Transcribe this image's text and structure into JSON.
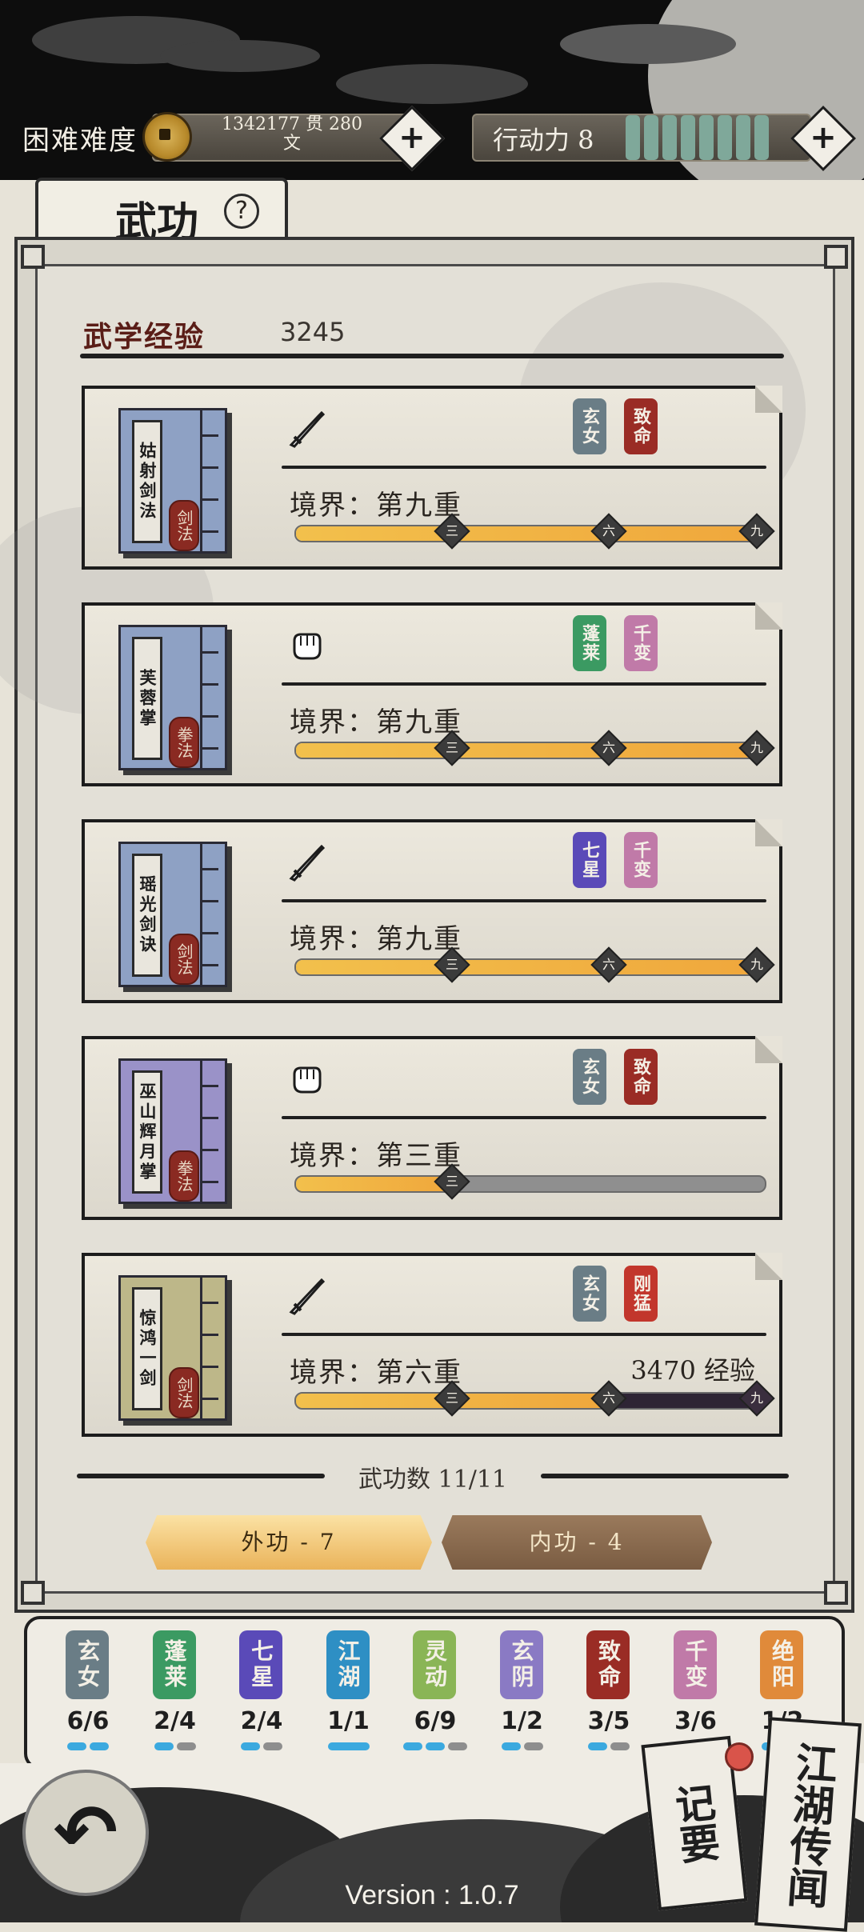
{
  "header": {
    "difficulty": "困难难度",
    "money_line1": "1342177 贯  280",
    "money_line2": "文",
    "add_money_label": "+",
    "action_power_label": "行动力 8",
    "action_power_value": 8,
    "add_power_label": "+"
  },
  "tab": {
    "title": "武功",
    "help": "?"
  },
  "experience": {
    "label": "武学经验",
    "value": "3245"
  },
  "skills": [
    {
      "name": "姑射剑法",
      "type": "剑法",
      "weapon_icon": "sword-icon",
      "realm": "境界：第九重",
      "exp": "",
      "progress": 1.0,
      "book_color": "#8ea1c4",
      "seals": [
        {
          "text": "玄女",
          "color": "#6a7d86"
        },
        {
          "text": "致命",
          "color": "#9a2c25"
        }
      ]
    },
    {
      "name": "芙蓉掌",
      "type": "拳法",
      "weapon_icon": "fist-icon",
      "realm": "境界：第九重",
      "exp": "",
      "progress": 1.0,
      "book_color": "#8ea1c4",
      "seals": [
        {
          "text": "蓬莱",
          "color": "#3b9a62"
        },
        {
          "text": "千变",
          "color": "#c07aa8"
        }
      ]
    },
    {
      "name": "瑶光剑诀",
      "type": "剑法",
      "weapon_icon": "sword-icon",
      "realm": "境界：第九重",
      "exp": "",
      "progress": 1.0,
      "book_color": "#8ea1c4",
      "seals": [
        {
          "text": "七星",
          "color": "#5a4ab8"
        },
        {
          "text": "千变",
          "color": "#c07aa8"
        }
      ]
    },
    {
      "name": "巫山辉月掌",
      "type": "拳法",
      "weapon_icon": "fist-icon",
      "realm": "境界：第三重",
      "exp": "",
      "progress": 0.333,
      "book_color": "#9a92c8",
      "seals": [
        {
          "text": "玄女",
          "color": "#6a7d86"
        },
        {
          "text": "致命",
          "color": "#9a2c25"
        }
      ]
    },
    {
      "name": "惊鸿一剑",
      "type": "剑法",
      "weapon_icon": "sword-icon",
      "realm": "境界：第六重",
      "exp": "3470 经验",
      "progress": 0.667,
      "book_color": "#bdb789",
      "seals": [
        {
          "text": "玄女",
          "color": "#6a7d86"
        },
        {
          "text": "刚猛",
          "color": "#c2362c"
        }
      ]
    }
  ],
  "markers": [
    "三",
    "六",
    "九"
  ],
  "count_label": "武功数 11/11",
  "buttons": {
    "outer": "外功 - 7",
    "inner": "内功 - 4"
  },
  "sect_tray": [
    {
      "text": "玄女",
      "count": "6/6",
      "pips": [
        1,
        1
      ],
      "color": "#6a7d86"
    },
    {
      "text": "蓬莱",
      "count": "2/4",
      "pips": [
        1,
        0
      ],
      "color": "#3b9a62"
    },
    {
      "text": "七星",
      "count": "2/4",
      "pips": [
        1,
        0
      ],
      "color": "#5a4ab8"
    },
    {
      "text": "江湖",
      "count": "1/1",
      "pips": [
        1
      ],
      "color": "#2e8fc4"
    },
    {
      "text": "灵动",
      "count": "6/9",
      "pips": [
        1,
        1,
        0
      ],
      "color": "#8ab556"
    },
    {
      "text": "玄阴",
      "count": "1/2",
      "pips": [
        1,
        0
      ],
      "color": "#8a7ac4"
    },
    {
      "text": "致命",
      "count": "3/5",
      "pips": [
        1,
        0
      ],
      "color": "#9a2c25"
    },
    {
      "text": "千变",
      "count": "3/6",
      "pips": [
        1,
        0
      ],
      "color": "#c07aa8"
    },
    {
      "text": "绝阳",
      "count": "1/2",
      "pips": [
        1,
        0
      ],
      "color": "#e08a3a"
    }
  ],
  "footer": {
    "notes_label": "记要",
    "rumors_label": "江湖传闻",
    "version": "Version : 1.0.7",
    "back_icon": "back-arrow-icon"
  }
}
